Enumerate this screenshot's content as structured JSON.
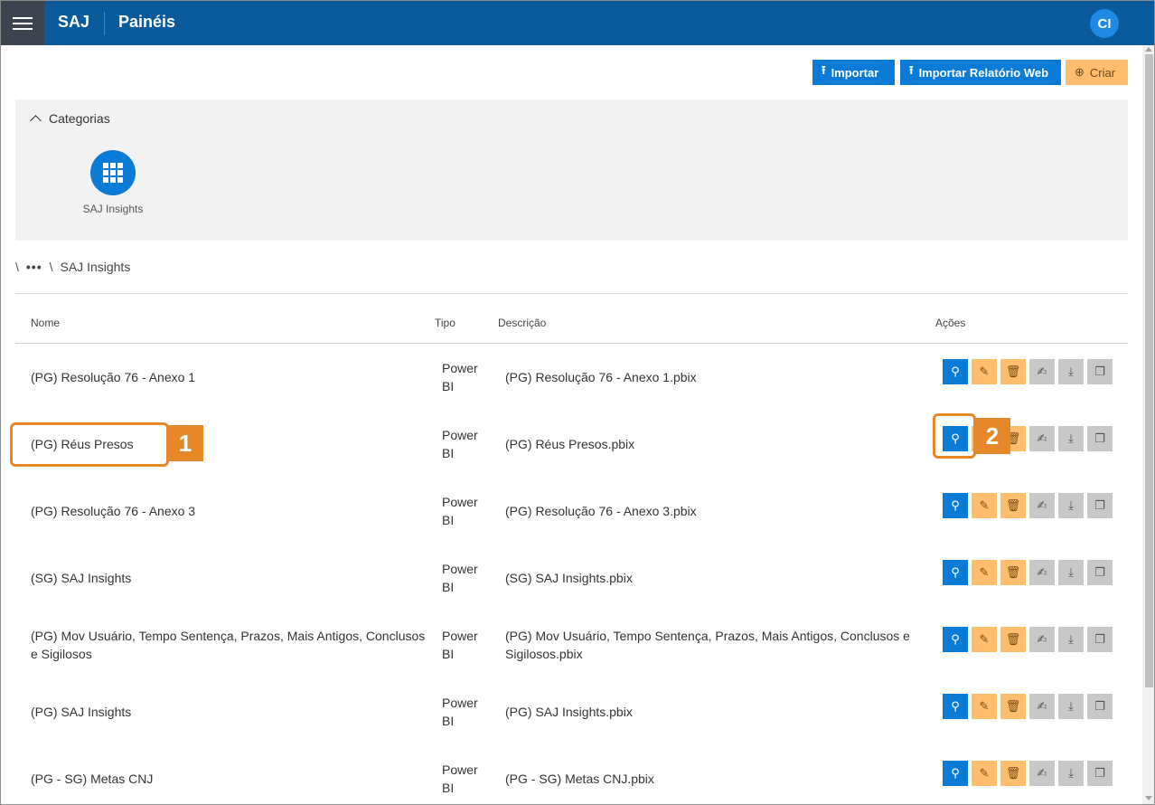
{
  "header": {
    "brand": "SAJ",
    "page_title": "Painéis",
    "avatar": "CI"
  },
  "toolbar": {
    "import_label": "Importar",
    "import_web_label": "Importar Relatório Web",
    "create_label": "Criar"
  },
  "categories": {
    "toggle_label": "Categorias",
    "items": [
      {
        "label": "SAJ Insights",
        "icon": "grid-icon"
      }
    ]
  },
  "breadcrumb": {
    "sep1": "\\",
    "dots": "•••",
    "sep2": "\\",
    "current": "SAJ Insights"
  },
  "table": {
    "headers": {
      "name": "Nome",
      "type": "Tipo",
      "description": "Descrição",
      "actions": "Ações"
    },
    "rows": [
      {
        "name": "(PG) Resolução 76 - Anexo 1",
        "type": "Power BI",
        "description": "(PG) Resolução 76 - Anexo 1.pbix"
      },
      {
        "name": "(PG) Réus Presos",
        "type": "Power BI",
        "description": "(PG) Réus Presos.pbix"
      },
      {
        "name": "(PG) Resolução 76 - Anexo 3",
        "type": "Power BI",
        "description": "(PG) Resolução 76 - Anexo 3.pbix"
      },
      {
        "name": "(SG) SAJ Insights",
        "type": "Power BI",
        "description": "(SG) SAJ Insights.pbix"
      },
      {
        "name": "(PG) Mov Usuário, Tempo Sentença, Prazos, Mais Antigos, Conclusos e Sigilosos",
        "type": "Power BI",
        "description": "(PG) Mov Usuário, Tempo Sentença, Prazos, Mais Antigos, Conclusos e Sigilosos.pbix"
      },
      {
        "name": "(PG) SAJ Insights",
        "type": "Power BI",
        "description": "(PG) SAJ Insights.pbix"
      },
      {
        "name": "(PG - SG) Metas CNJ",
        "type": "Power BI",
        "description": "(PG - SG) Metas CNJ.pbix"
      }
    ]
  },
  "annotations": {
    "step1": "1",
    "step2": "2"
  },
  "colors": {
    "header_bg": "#0a5a9c",
    "primary": "#0a7bd6",
    "warning": "#ffbd6e",
    "neutral": "#c8c8c8",
    "callout": "#e6882a"
  }
}
